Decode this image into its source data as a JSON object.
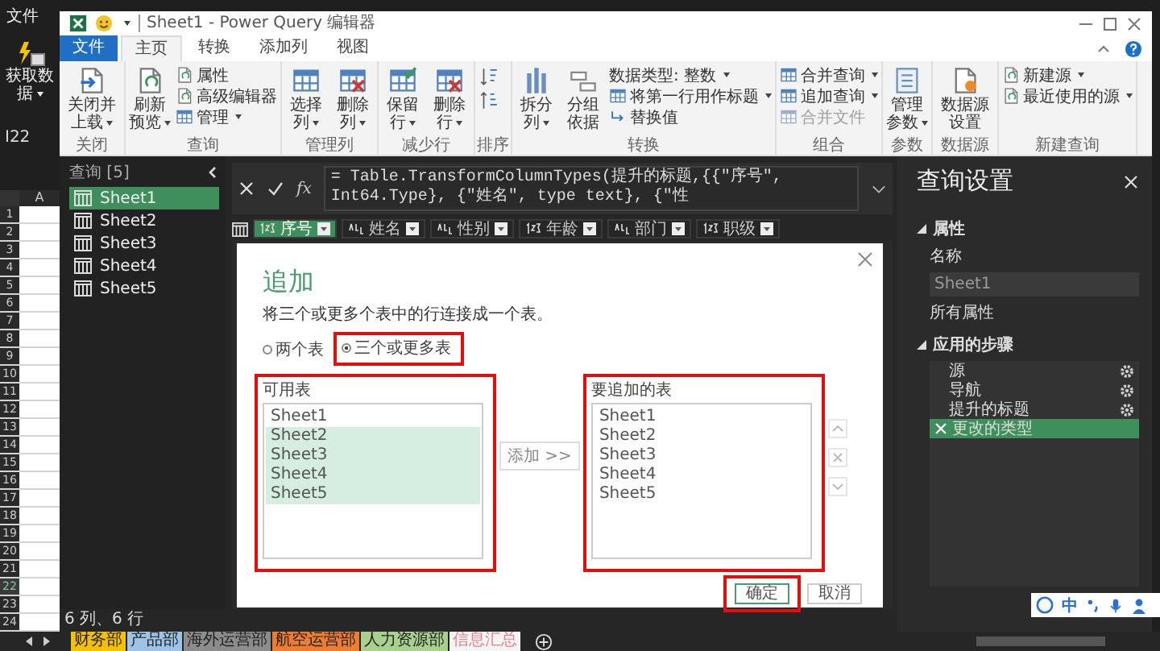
{
  "excel": {
    "file_menu": "文件",
    "get_data": "获取数据",
    "name_box": "I22",
    "column_header": "A",
    "rows": [
      {
        "label": "1",
        "selected": false
      },
      {
        "label": "2",
        "selected": false
      },
      {
        "label": "3",
        "selected": false
      },
      {
        "label": "4",
        "selected": false
      },
      {
        "label": "5",
        "selected": false
      },
      {
        "label": "6",
        "selected": false
      },
      {
        "label": "7",
        "selected": false
      },
      {
        "label": "8",
        "selected": false
      },
      {
        "label": "9",
        "selected": false
      },
      {
        "label": "10",
        "selected": false
      },
      {
        "label": "11",
        "selected": false
      },
      {
        "label": "12",
        "selected": false
      },
      {
        "label": "13",
        "selected": false
      },
      {
        "label": "14",
        "selected": false
      },
      {
        "label": "15",
        "selected": false
      },
      {
        "label": "16",
        "selected": false
      },
      {
        "label": "17",
        "selected": false
      },
      {
        "label": "18",
        "selected": false
      },
      {
        "label": "19",
        "selected": false
      },
      {
        "label": "20",
        "selected": false
      },
      {
        "label": "21",
        "selected": false
      },
      {
        "label": "22",
        "selected": true
      },
      {
        "label": "23",
        "selected": false
      },
      {
        "label": "24",
        "selected": false
      }
    ]
  },
  "sheet_tabs": [
    {
      "label": "财务部",
      "color": "#f5c000",
      "selected": false
    },
    {
      "label": "产品部",
      "color": "#9dc3e6",
      "selected": false
    },
    {
      "label": "海外运营部",
      "color": "#8c8c8c",
      "selected": false
    },
    {
      "label": "航空运营部",
      "color": "#ed7d31",
      "selected": false
    },
    {
      "label": "人力资源部",
      "color": "#a9d08e",
      "selected": false
    },
    {
      "label": "信息汇总",
      "color": "#e8808c",
      "selected": true
    }
  ],
  "window": {
    "title": "Sheet1 - Power Query 编辑器"
  },
  "ribbon_tabs": [
    {
      "label": "文件",
      "kind": "file",
      "selected": false
    },
    {
      "label": "主页",
      "kind": "tab",
      "selected": true
    },
    {
      "label": "转换",
      "kind": "tab",
      "selected": false
    },
    {
      "label": "添加列",
      "kind": "tab",
      "selected": false
    },
    {
      "label": "视图",
      "kind": "tab",
      "selected": false
    }
  ],
  "ribbon_groups": [
    {
      "label": "关闭",
      "items": [
        {
          "kind": "large",
          "label": "关闭并上载",
          "dropdown": true
        }
      ]
    },
    {
      "label": "查询",
      "items": [
        {
          "kind": "large",
          "label": "刷新预览",
          "dropdown": true
        },
        {
          "kind": "stack",
          "buttons": [
            {
              "label": "属性",
              "dropdown": false,
              "disabled": false
            },
            {
              "label": "高级编辑器",
              "dropdown": false,
              "disabled": false
            },
            {
              "label": "管理",
              "dropdown": true,
              "disabled": false
            }
          ]
        }
      ]
    },
    {
      "label": "管理列",
      "items": [
        {
          "kind": "large",
          "label": "选择列",
          "dropdown": true
        },
        {
          "kind": "large",
          "label": "删除列",
          "dropdown": true
        }
      ]
    },
    {
      "label": "减少行",
      "items": [
        {
          "kind": "large",
          "label": "保留行",
          "dropdown": true
        },
        {
          "kind": "large",
          "label": "删除行",
          "dropdown": true
        }
      ]
    },
    {
      "label": "排序",
      "items": [
        {
          "kind": "sort"
        }
      ]
    },
    {
      "label": "转换",
      "items": [
        {
          "kind": "large",
          "label": "拆分列",
          "dropdown": true
        },
        {
          "kind": "large",
          "label": "分组依据",
          "dropdown": false
        },
        {
          "kind": "stack",
          "buttons": [
            {
              "label": "数据类型: 整数",
              "dropdown": true,
              "disabled": false
            },
            {
              "label": "将第一行用作标题",
              "dropdown": true,
              "disabled": false
            },
            {
              "label": "替换值",
              "dropdown": false,
              "disabled": false
            }
          ]
        }
      ]
    },
    {
      "label": "组合",
      "items": [
        {
          "kind": "stack",
          "buttons": [
            {
              "label": "合并查询",
              "dropdown": true,
              "disabled": false
            },
            {
              "label": "追加查询",
              "dropdown": true,
              "disabled": false
            },
            {
              "label": "合并文件",
              "dropdown": false,
              "disabled": true
            }
          ]
        }
      ]
    },
    {
      "label": "参数",
      "items": [
        {
          "kind": "large",
          "label": "管理参数",
          "dropdown": true
        }
      ]
    },
    {
      "label": "数据源",
      "items": [
        {
          "kind": "large",
          "label": "数据源设置",
          "dropdown": false
        }
      ]
    },
    {
      "label": "新建查询",
      "items": [
        {
          "kind": "stack",
          "buttons": [
            {
              "label": "新建源",
              "dropdown": true,
              "disabled": false
            },
            {
              "label": "最近使用的源",
              "dropdown": true,
              "disabled": false
            }
          ]
        }
      ]
    }
  ],
  "queries": {
    "header": "查询 [5]",
    "items": [
      {
        "label": "Sheet1",
        "selected": true
      },
      {
        "label": "Sheet2",
        "selected": false
      },
      {
        "label": "Sheet3",
        "selected": false
      },
      {
        "label": "Sheet4",
        "selected": false
      },
      {
        "label": "Sheet5",
        "selected": false
      }
    ]
  },
  "formula_bar": {
    "function_label": "fx",
    "formula": "= Table.TransformColumnTypes(提升的标题,{{\"序号\", Int64.Type}, {\"姓名\", type text}, {\"性"
  },
  "columns": [
    {
      "label": "序号",
      "kind": "number",
      "selected": true
    },
    {
      "label": "姓名",
      "kind": "text",
      "selected": false
    },
    {
      "label": "性别",
      "kind": "text",
      "selected": false
    },
    {
      "label": "年龄",
      "kind": "number",
      "selected": false
    },
    {
      "label": "部门",
      "kind": "text",
      "selected": false
    },
    {
      "label": "职级",
      "kind": "number",
      "selected": false
    }
  ],
  "status_bar": "6 列、6 行",
  "settings": {
    "title": "查询设置",
    "properties": {
      "header": "属性",
      "expanded": true,
      "name_label": "名称",
      "name_value": "Sheet1",
      "all_properties": "所有属性"
    },
    "steps": {
      "header": "应用的步骤",
      "expanded": true,
      "items": [
        {
          "label": "源",
          "selected": false,
          "settings": true
        },
        {
          "label": "导航",
          "selected": false,
          "settings": true
        },
        {
          "label": "提升的标题",
          "selected": false,
          "settings": true
        },
        {
          "label": "更改的类型",
          "selected": true,
          "settings": false
        }
      ]
    }
  },
  "dialog": {
    "title": "追加",
    "description": "将三个或更多个表中的行连接成一个表。",
    "modes": [
      {
        "label": "两个表",
        "selected": false,
        "highlighted": false
      },
      {
        "label": "三个或更多表",
        "selected": true,
        "highlighted": true
      }
    ],
    "available": {
      "label": "可用表",
      "highlighted": true,
      "items": [
        {
          "label": "Sheet1",
          "selected": false
        },
        {
          "label": "Sheet2",
          "selected": true
        },
        {
          "label": "Sheet3",
          "selected": true
        },
        {
          "label": "Sheet4",
          "selected": true
        },
        {
          "label": "Sheet5",
          "selected": true
        }
      ]
    },
    "add_button": "添加 >>",
    "append": {
      "label": "要追加的表",
      "highlighted": true,
      "items": [
        {
          "label": "Sheet1"
        },
        {
          "label": "Sheet2"
        },
        {
          "label": "Sheet3"
        },
        {
          "label": "Sheet4"
        },
        {
          "label": "Sheet5"
        }
      ]
    },
    "order_buttons": [
      {
        "kind": "up",
        "disabled": true
      },
      {
        "kind": "remove",
        "disabled": true
      },
      {
        "kind": "down",
        "disabled": true
      }
    ],
    "buttons": [
      {
        "label": "确定",
        "kind": "primary",
        "highlighted": true
      },
      {
        "label": "取消",
        "kind": "secondary",
        "highlighted": false
      }
    ]
  },
  "ime": {
    "label": "中"
  }
}
